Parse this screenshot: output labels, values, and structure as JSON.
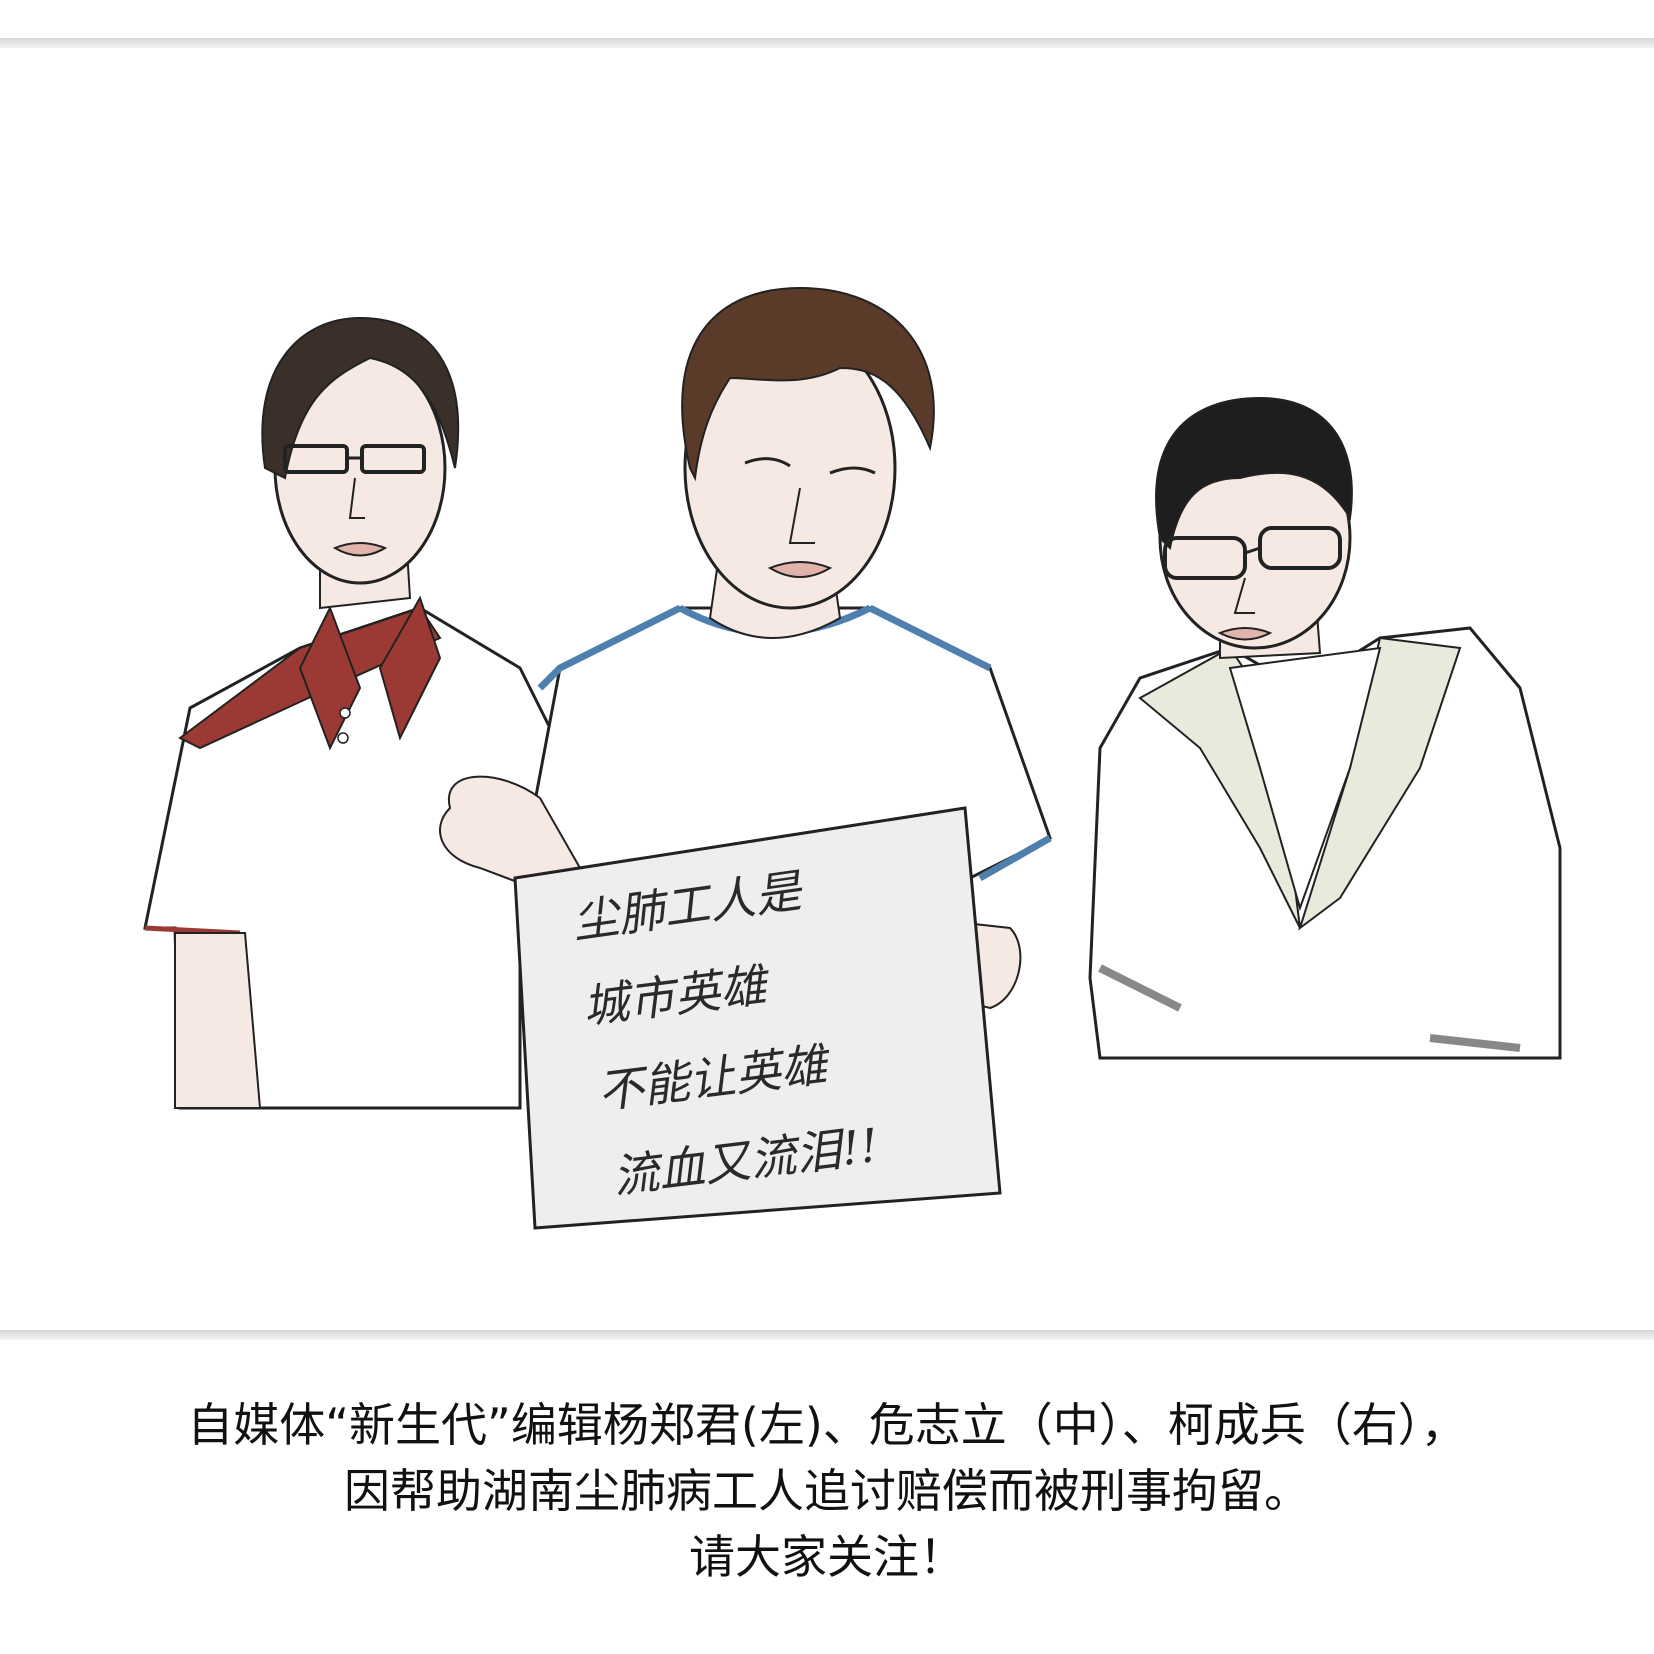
{
  "sign": {
    "lines": [
      "尘肺工人是",
      "城市英雄",
      "不能让英雄",
      "流血又流泪!!"
    ]
  },
  "caption": {
    "line1": "自媒体“新生代”编辑杨郑君(左)、危志立（中）、柯成兵（右），",
    "line2": "因帮助湖南尘肺病工人追讨赔偿而被刑事拘留。",
    "line3": "请大家关注！"
  },
  "colors": {
    "skin": "#f6e9e3",
    "red_collar": "#9b3a35",
    "blue_trim": "#4f7fae",
    "brown_hair": "#5a3b2a",
    "dark_hair": "#1e1e1e",
    "paper": "#eeeeee",
    "hoodie_lining": "#e9e9dc"
  },
  "people": [
    {
      "position": "left",
      "shirt": "white polo with red collar",
      "glasses": true
    },
    {
      "position": "center",
      "shirt": "white t-shirt with blue trim",
      "glasses": false,
      "holding": "handwritten sign"
    },
    {
      "position": "right",
      "shirt": "white hoodie",
      "glasses": true
    }
  ]
}
